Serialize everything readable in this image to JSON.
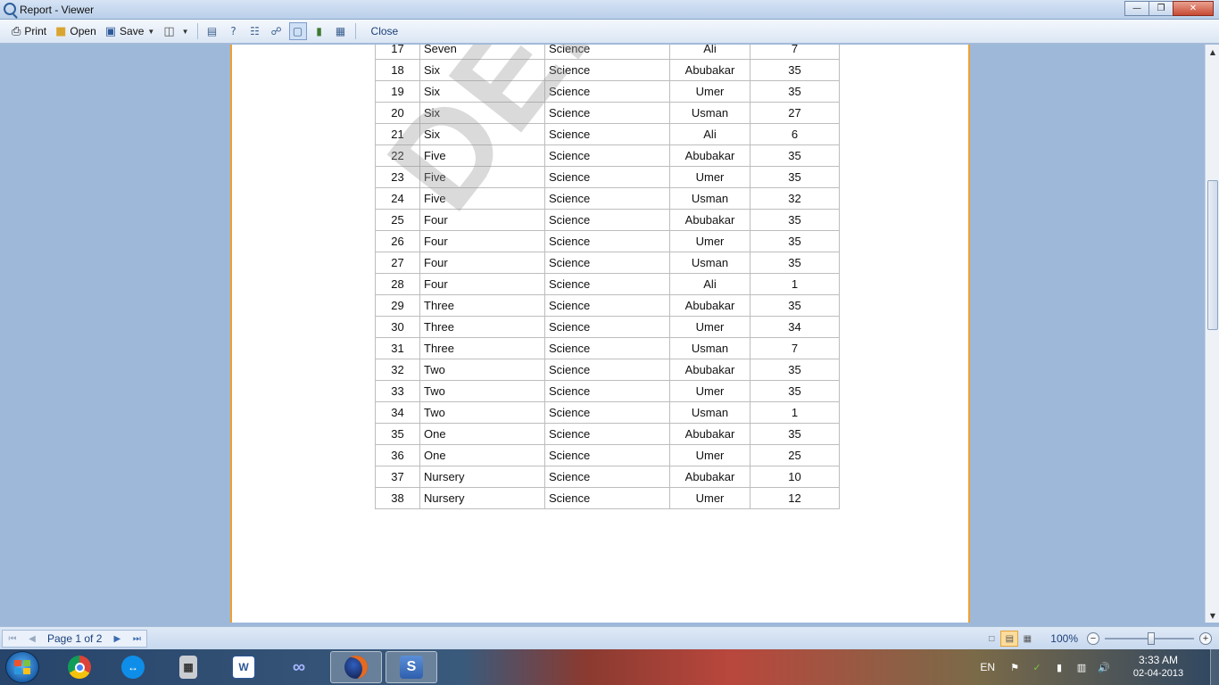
{
  "window": {
    "title": "Report - Viewer"
  },
  "toolbar": {
    "print_label": "Print",
    "open_label": "Open",
    "save_label": "Save",
    "close_label": "Close"
  },
  "report": {
    "watermark": "DEMO",
    "rows": [
      {
        "id": "17",
        "class": "Seven",
        "subject": "Science",
        "name": "Ali",
        "value": "7"
      },
      {
        "id": "18",
        "class": "Six",
        "subject": "Science",
        "name": "Abubakar",
        "value": "35"
      },
      {
        "id": "19",
        "class": "Six",
        "subject": "Science",
        "name": "Umer",
        "value": "35"
      },
      {
        "id": "20",
        "class": "Six",
        "subject": "Science",
        "name": "Usman",
        "value": "27"
      },
      {
        "id": "21",
        "class": "Six",
        "subject": "Science",
        "name": "Ali",
        "value": "6"
      },
      {
        "id": "22",
        "class": "Five",
        "subject": "Science",
        "name": "Abubakar",
        "value": "35"
      },
      {
        "id": "23",
        "class": "Five",
        "subject": "Science",
        "name": "Umer",
        "value": "35"
      },
      {
        "id": "24",
        "class": "Five",
        "subject": "Science",
        "name": "Usman",
        "value": "32"
      },
      {
        "id": "25",
        "class": "Four",
        "subject": "Science",
        "name": "Abubakar",
        "value": "35"
      },
      {
        "id": "26",
        "class": "Four",
        "subject": "Science",
        "name": "Umer",
        "value": "35"
      },
      {
        "id": "27",
        "class": "Four",
        "subject": "Science",
        "name": "Usman",
        "value": "35"
      },
      {
        "id": "28",
        "class": "Four",
        "subject": "Science",
        "name": "Ali",
        "value": "1"
      },
      {
        "id": "29",
        "class": "Three",
        "subject": "Science",
        "name": "Abubakar",
        "value": "35"
      },
      {
        "id": "30",
        "class": "Three",
        "subject": "Science",
        "name": "Umer",
        "value": "34"
      },
      {
        "id": "31",
        "class": "Three",
        "subject": "Science",
        "name": "Usman",
        "value": "7"
      },
      {
        "id": "32",
        "class": "Two",
        "subject": "Science",
        "name": "Abubakar",
        "value": "35"
      },
      {
        "id": "33",
        "class": "Two",
        "subject": "Science",
        "name": "Umer",
        "value": "35"
      },
      {
        "id": "34",
        "class": "Two",
        "subject": "Science",
        "name": "Usman",
        "value": "1"
      },
      {
        "id": "35",
        "class": "One",
        "subject": "Science",
        "name": "Abubakar",
        "value": "35"
      },
      {
        "id": "36",
        "class": "One",
        "subject": "Science",
        "name": "Umer",
        "value": "25"
      },
      {
        "id": "37",
        "class": "Nursery",
        "subject": "Science",
        "name": "Abubakar",
        "value": "10"
      },
      {
        "id": "38",
        "class": "Nursery",
        "subject": "Science",
        "name": "Umer",
        "value": "12"
      }
    ]
  },
  "statusbar": {
    "page_label": "Page 1 of 2",
    "zoom_label": "100%"
  },
  "taskbar": {
    "apps": [
      "windows-start",
      "chrome",
      "teamviewer",
      "calculator",
      "word",
      "infinity-app",
      "firefox",
      "report-designer"
    ],
    "lang": "EN",
    "time": "3:33 AM",
    "date": "02-04-2013"
  }
}
